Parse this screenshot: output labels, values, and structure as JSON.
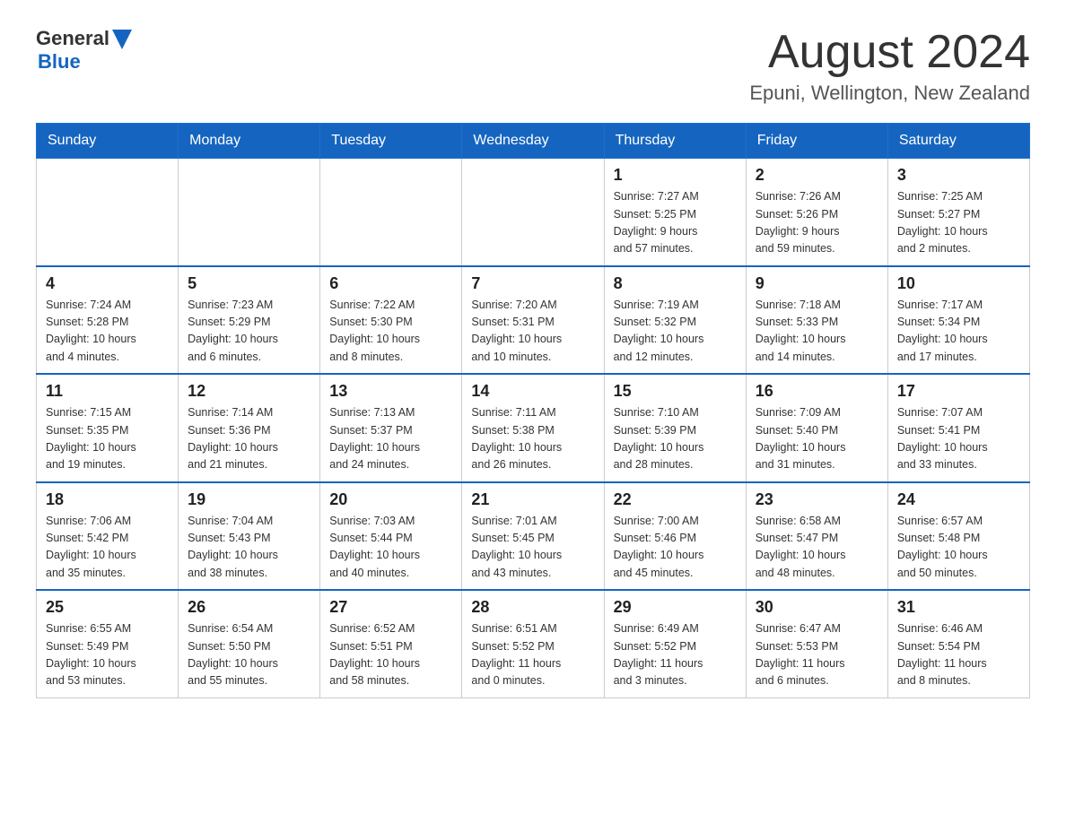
{
  "header": {
    "logo_general": "General",
    "logo_blue": "Blue",
    "month_title": "August 2024",
    "location": "Epuni, Wellington, New Zealand"
  },
  "weekdays": [
    "Sunday",
    "Monday",
    "Tuesday",
    "Wednesday",
    "Thursday",
    "Friday",
    "Saturday"
  ],
  "weeks": [
    [
      {
        "day": "",
        "info": ""
      },
      {
        "day": "",
        "info": ""
      },
      {
        "day": "",
        "info": ""
      },
      {
        "day": "",
        "info": ""
      },
      {
        "day": "1",
        "info": "Sunrise: 7:27 AM\nSunset: 5:25 PM\nDaylight: 9 hours\nand 57 minutes."
      },
      {
        "day": "2",
        "info": "Sunrise: 7:26 AM\nSunset: 5:26 PM\nDaylight: 9 hours\nand 59 minutes."
      },
      {
        "day": "3",
        "info": "Sunrise: 7:25 AM\nSunset: 5:27 PM\nDaylight: 10 hours\nand 2 minutes."
      }
    ],
    [
      {
        "day": "4",
        "info": "Sunrise: 7:24 AM\nSunset: 5:28 PM\nDaylight: 10 hours\nand 4 minutes."
      },
      {
        "day": "5",
        "info": "Sunrise: 7:23 AM\nSunset: 5:29 PM\nDaylight: 10 hours\nand 6 minutes."
      },
      {
        "day": "6",
        "info": "Sunrise: 7:22 AM\nSunset: 5:30 PM\nDaylight: 10 hours\nand 8 minutes."
      },
      {
        "day": "7",
        "info": "Sunrise: 7:20 AM\nSunset: 5:31 PM\nDaylight: 10 hours\nand 10 minutes."
      },
      {
        "day": "8",
        "info": "Sunrise: 7:19 AM\nSunset: 5:32 PM\nDaylight: 10 hours\nand 12 minutes."
      },
      {
        "day": "9",
        "info": "Sunrise: 7:18 AM\nSunset: 5:33 PM\nDaylight: 10 hours\nand 14 minutes."
      },
      {
        "day": "10",
        "info": "Sunrise: 7:17 AM\nSunset: 5:34 PM\nDaylight: 10 hours\nand 17 minutes."
      }
    ],
    [
      {
        "day": "11",
        "info": "Sunrise: 7:15 AM\nSunset: 5:35 PM\nDaylight: 10 hours\nand 19 minutes."
      },
      {
        "day": "12",
        "info": "Sunrise: 7:14 AM\nSunset: 5:36 PM\nDaylight: 10 hours\nand 21 minutes."
      },
      {
        "day": "13",
        "info": "Sunrise: 7:13 AM\nSunset: 5:37 PM\nDaylight: 10 hours\nand 24 minutes."
      },
      {
        "day": "14",
        "info": "Sunrise: 7:11 AM\nSunset: 5:38 PM\nDaylight: 10 hours\nand 26 minutes."
      },
      {
        "day": "15",
        "info": "Sunrise: 7:10 AM\nSunset: 5:39 PM\nDaylight: 10 hours\nand 28 minutes."
      },
      {
        "day": "16",
        "info": "Sunrise: 7:09 AM\nSunset: 5:40 PM\nDaylight: 10 hours\nand 31 minutes."
      },
      {
        "day": "17",
        "info": "Sunrise: 7:07 AM\nSunset: 5:41 PM\nDaylight: 10 hours\nand 33 minutes."
      }
    ],
    [
      {
        "day": "18",
        "info": "Sunrise: 7:06 AM\nSunset: 5:42 PM\nDaylight: 10 hours\nand 35 minutes."
      },
      {
        "day": "19",
        "info": "Sunrise: 7:04 AM\nSunset: 5:43 PM\nDaylight: 10 hours\nand 38 minutes."
      },
      {
        "day": "20",
        "info": "Sunrise: 7:03 AM\nSunset: 5:44 PM\nDaylight: 10 hours\nand 40 minutes."
      },
      {
        "day": "21",
        "info": "Sunrise: 7:01 AM\nSunset: 5:45 PM\nDaylight: 10 hours\nand 43 minutes."
      },
      {
        "day": "22",
        "info": "Sunrise: 7:00 AM\nSunset: 5:46 PM\nDaylight: 10 hours\nand 45 minutes."
      },
      {
        "day": "23",
        "info": "Sunrise: 6:58 AM\nSunset: 5:47 PM\nDaylight: 10 hours\nand 48 minutes."
      },
      {
        "day": "24",
        "info": "Sunrise: 6:57 AM\nSunset: 5:48 PM\nDaylight: 10 hours\nand 50 minutes."
      }
    ],
    [
      {
        "day": "25",
        "info": "Sunrise: 6:55 AM\nSunset: 5:49 PM\nDaylight: 10 hours\nand 53 minutes."
      },
      {
        "day": "26",
        "info": "Sunrise: 6:54 AM\nSunset: 5:50 PM\nDaylight: 10 hours\nand 55 minutes."
      },
      {
        "day": "27",
        "info": "Sunrise: 6:52 AM\nSunset: 5:51 PM\nDaylight: 10 hours\nand 58 minutes."
      },
      {
        "day": "28",
        "info": "Sunrise: 6:51 AM\nSunset: 5:52 PM\nDaylight: 11 hours\nand 0 minutes."
      },
      {
        "day": "29",
        "info": "Sunrise: 6:49 AM\nSunset: 5:52 PM\nDaylight: 11 hours\nand 3 minutes."
      },
      {
        "day": "30",
        "info": "Sunrise: 6:47 AM\nSunset: 5:53 PM\nDaylight: 11 hours\nand 6 minutes."
      },
      {
        "day": "31",
        "info": "Sunrise: 6:46 AM\nSunset: 5:54 PM\nDaylight: 11 hours\nand 8 minutes."
      }
    ]
  ]
}
